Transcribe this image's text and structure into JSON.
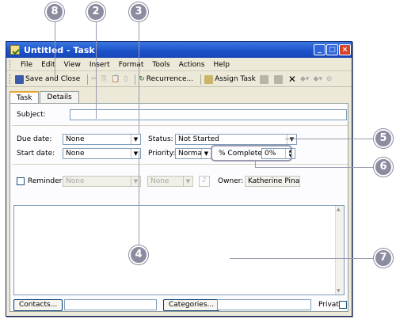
{
  "window": {
    "title": "Untitled - Task"
  },
  "menu": [
    "File",
    "Edit",
    "View",
    "Insert",
    "Format",
    "Tools",
    "Actions",
    "Help"
  ],
  "toolbar": {
    "save_close": "Save and Close",
    "recurrence": "Recurrence...",
    "assign_task": "Assign Task"
  },
  "tabs": [
    "Task",
    "Details"
  ],
  "form": {
    "subject_label": "Subject:",
    "due_date_label": "Due date:",
    "due_date_value": "None",
    "start_date_label": "Start date:",
    "start_date_value": "None",
    "status_label": "Status:",
    "status_value": "Not Started",
    "priority_label": "Priority:",
    "priority_value": "Normal",
    "percent_label": "% Complete:",
    "percent_value": "0%",
    "reminder_label": "Reminder:",
    "reminder_date": "None",
    "reminder_time": "None",
    "owner_label": "Owner:",
    "owner_value": "Katherine Pinard"
  },
  "footer": {
    "contacts": "Contacts...",
    "categories": "Categories...",
    "private": "Private"
  },
  "callouts": [
    "8",
    "2",
    "3",
    "5",
    "6",
    "4",
    "7"
  ]
}
